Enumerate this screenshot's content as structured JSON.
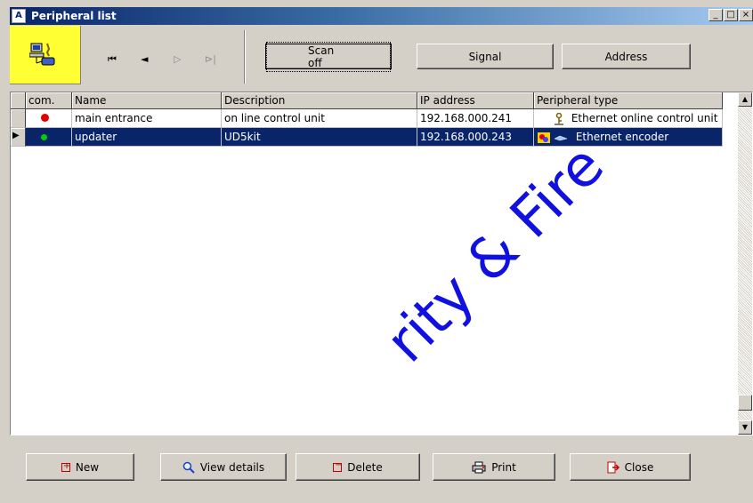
{
  "window": {
    "title": "Peripheral list",
    "controls": [
      "_",
      "□",
      "×"
    ]
  },
  "toolbar": {
    "nav": [
      {
        "icon": "first-record-icon",
        "glyph": "⏮"
      },
      {
        "icon": "prev-record-icon",
        "glyph": "◄"
      },
      {
        "icon": "next-record-icon",
        "glyph": "▷"
      },
      {
        "icon": "last-record-icon",
        "glyph": "⊳|"
      }
    ],
    "scan_label": "Scan off",
    "signal_label": "Signal",
    "address_label": "Address"
  },
  "table": {
    "columns": [
      "com.",
      "Name",
      "Description",
      "IP address",
      "Peripheral type"
    ],
    "rows": [
      {
        "status_color": "#e00000",
        "name": "main entrance",
        "description": "on line control unit",
        "ip": "192.168.000.241",
        "type": "Ethernet online control unit",
        "type_icon": "key-icon",
        "selected": false
      },
      {
        "status_color": "#00d000",
        "name": "updater",
        "description": "UD5kit",
        "ip": "192.168.000.243",
        "type": "Ethernet encoder",
        "type_icon": "encoder-icon",
        "selected": true
      }
    ]
  },
  "footer": {
    "new_label": "New",
    "view_details_label": "View details",
    "delete_label": "Delete",
    "print_label": "Print",
    "close_label": "Close"
  },
  "watermark": "rity & Fire",
  "colors": {
    "selection": "#0a246a",
    "logo_bg": "#ffff33",
    "watermark": "#1010e0"
  }
}
